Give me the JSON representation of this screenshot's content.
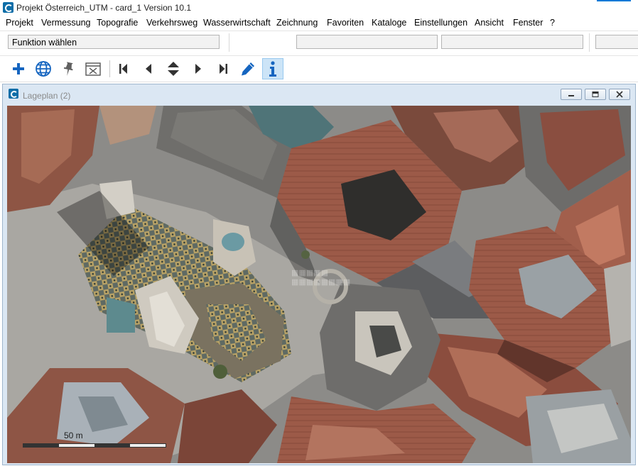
{
  "window": {
    "title": "Projekt Österreich_UTM - card_1 Version 10.1",
    "accent_color": "#0078d7"
  },
  "menu": {
    "items": [
      "Projekt",
      "Vermessung",
      "Topografie",
      "Verkehrsweg",
      "Wasserwirtschaft",
      "Zeichnung",
      "Favoriten",
      "Kataloge",
      "Einstellungen",
      "Ansicht",
      "Fenster",
      "?"
    ]
  },
  "command_bar": {
    "function_field": "Funktion wählen"
  },
  "toolbar": {
    "icons": [
      "plus-icon",
      "globe-icon",
      "pin-icon",
      "close-view-icon",
      "first-icon",
      "previous-icon",
      "up-down-icon",
      "next-icon",
      "last-icon",
      "pencil-icon",
      "info-icon"
    ],
    "active": "info-icon",
    "icon_color": "#1565c0"
  },
  "child_window": {
    "title": "Lageplan (2)",
    "buttons": [
      "minimize-icon",
      "restore-icon",
      "close-icon"
    ]
  },
  "map": {
    "scale_label": "50 m"
  }
}
